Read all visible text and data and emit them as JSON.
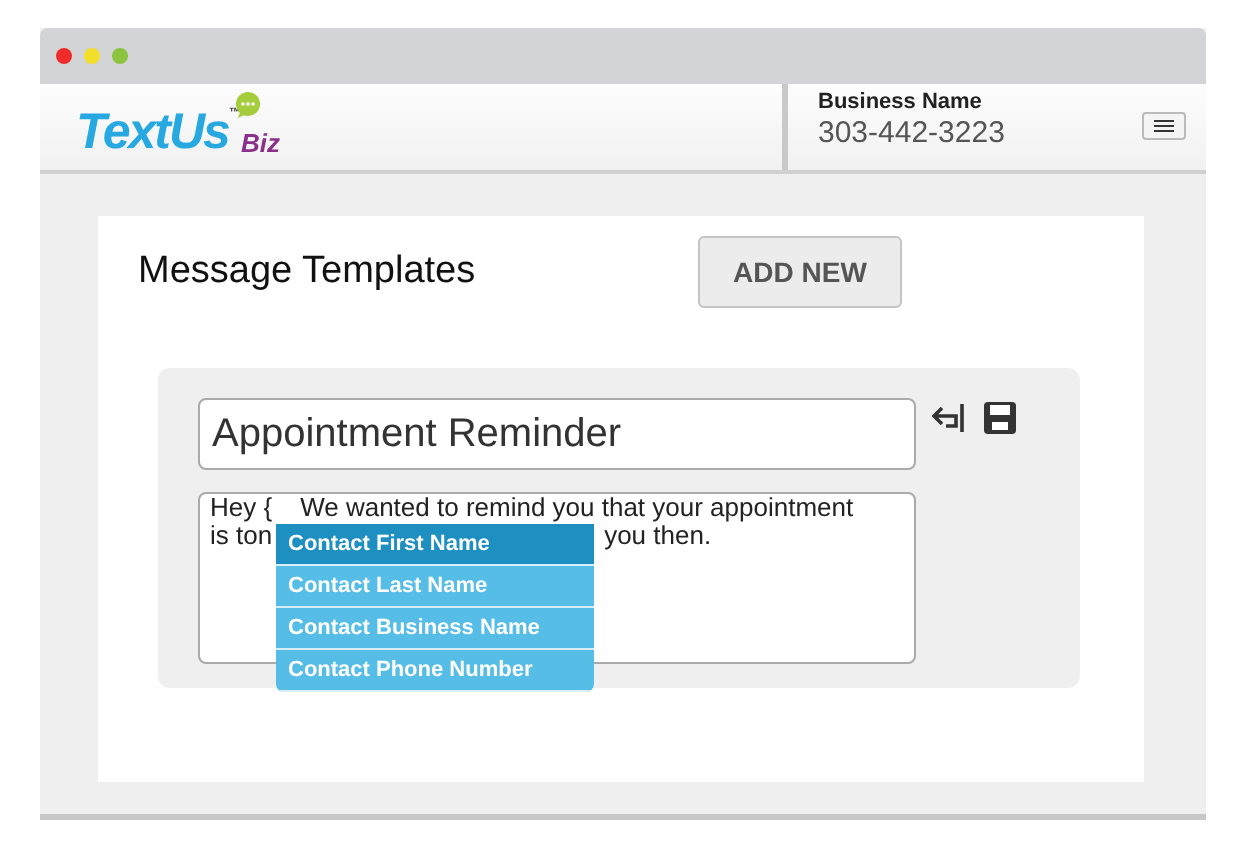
{
  "window": {
    "buttons": [
      {
        "color": "#ee2b2b"
      },
      {
        "color": "#f2df2a"
      },
      {
        "color": "#8cc33f"
      }
    ]
  },
  "header": {
    "logo": {
      "name": "TextUs",
      "tm": "™",
      "suffix": "Biz"
    },
    "business_label": "Business Name",
    "phone": "303-442-3223"
  },
  "page": {
    "title": "Message Templates",
    "add_button": "ADD NEW"
  },
  "template": {
    "name": "Appointment Reminder",
    "body_lines": [
      [
        "Hey {",
        "We wanted to remind you that your appointment"
      ],
      [
        "is ton",
        "you then."
      ]
    ]
  },
  "suggestions": [
    {
      "label": "Contact First Name",
      "selected": true
    },
    {
      "label": "Contact Last Name",
      "selected": false
    },
    {
      "label": "Contact Business Name",
      "selected": false
    },
    {
      "label": "Contact Phone Number",
      "selected": false
    }
  ]
}
